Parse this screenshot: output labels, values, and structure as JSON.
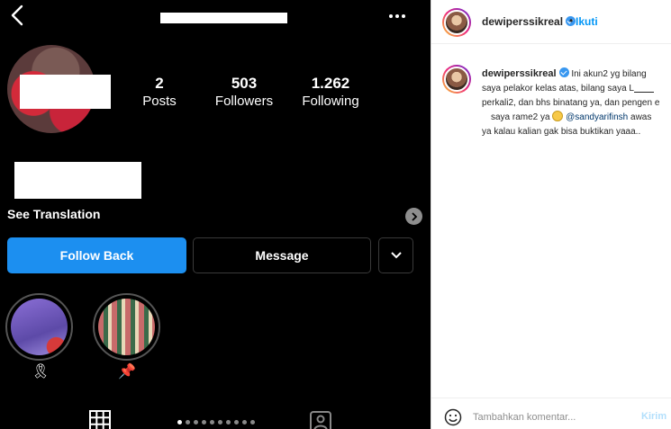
{
  "profile": {
    "stats": [
      {
        "value": "2",
        "label": "Posts"
      },
      {
        "value": "503",
        "label": "Followers"
      },
      {
        "value": "1.262",
        "label": "Following"
      }
    ],
    "see_translation": "See Translation",
    "buttons": {
      "follow_back": "Follow Back",
      "message": "Message"
    },
    "highlights": [
      {
        "emoji": "🎗"
      },
      {
        "emoji": "📌"
      }
    ],
    "carousel_dots": 10
  },
  "post": {
    "header": {
      "username": "dewiperssikreal",
      "separator": "•",
      "follow_label": "Ikuti"
    },
    "caption": {
      "username": "dewiperssikreal",
      "text_1": "Ini akun2 yg bilang saya pelakor kelas atas, bilang saya L",
      "text_2": "perkali2, dan bhs binatang ya, dan pengen e",
      "text_3": "saya rame2 ya ",
      "mention": "@sandyarifinsh",
      "text_4": " awas ya kalau kalian gak bisa buktikan yaaa.."
    },
    "comment": {
      "placeholder": "Tambahkan komentar...",
      "send_label": "Kirim"
    }
  },
  "colors": {
    "follow_back_bg": "#1c8ff0",
    "link_blue": "#0095f6",
    "send_disabled": "#b2dffc"
  }
}
